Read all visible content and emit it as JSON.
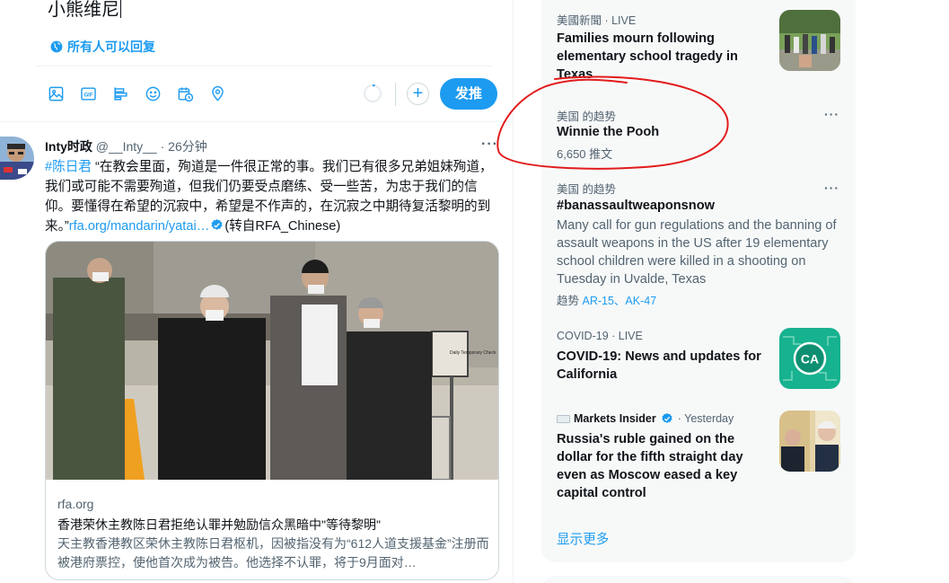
{
  "composer": {
    "text": "小熊维尼",
    "reply_setting": "所有人可以回复",
    "tweet_button": "发推",
    "tools": [
      "image-icon",
      "gif-icon",
      "poll-icon",
      "emoji-icon",
      "schedule-icon",
      "location-icon"
    ],
    "add_label": "+"
  },
  "tweet": {
    "name": "Inty时政",
    "handle": "@__Inty__",
    "separator": "·",
    "time": "26分钟",
    "more": "···",
    "hashtag": "#陈日君",
    "text": " “在教会里面，殉道是一件很正常的事。我们已有很多兄弟姐妹殉道，我们或可能不需要殉道，但我们仍要受点磨练、受一些苦，为忠于我们的信仰。要懂得在希望的沉寂中，希望是不作声的，在沉寂之中期待复活黎明的到来。”",
    "link": "rfa.org/mandarin/yatai…",
    "via": "(转自RFA_Chinese)",
    "card": {
      "domain": "rfa.org",
      "title": "香港荣休主教陈日君拒绝认罪并勉励信众黑暗中\"等待黎明\"",
      "description": "天主教香港教区荣休主教陈日君枢机，因被指没有为“612人道支援基金”注册而被港府票控，使他首次成为被告。他选择不认罪，将于9月面对…",
      "sign_text": "Daily Temporary Check"
    }
  },
  "trends": [
    {
      "meta": "美國新聞 · LIVE",
      "title": "Families mourn following elementary school tragedy in Texas"
    },
    {
      "meta": "美国 的趋势",
      "title": "Winnie the Pooh",
      "count": "6,650 推文",
      "more": "···"
    },
    {
      "meta": "美国 的趋势",
      "title": "#banassaultweaponsnow",
      "description": "Many call for gun regulations and the banning of assault weapons in the US after 19 elementary school children were killed in a shooting on Tuesday in Uvalde, Texas",
      "related_prefix": "趋势",
      "related": "AR-15、AK-47",
      "more": "···"
    },
    {
      "meta": "COVID-19 · LIVE",
      "title": "COVID-19: News and updates for California",
      "thumb_text": "CA"
    },
    {
      "source": "Markets Insider",
      "meta": "· Yesterday",
      "title": "Russia's ruble gained on the dollar for the fifth straight day even as Moscow eased a key capital control"
    }
  ],
  "show_more": "显示更多",
  "colors": {
    "accent": "#1d9bf0",
    "text": "#0f1419",
    "muted": "#536471",
    "panel": "#f7f9f9",
    "annotation": "#e21b1b"
  }
}
